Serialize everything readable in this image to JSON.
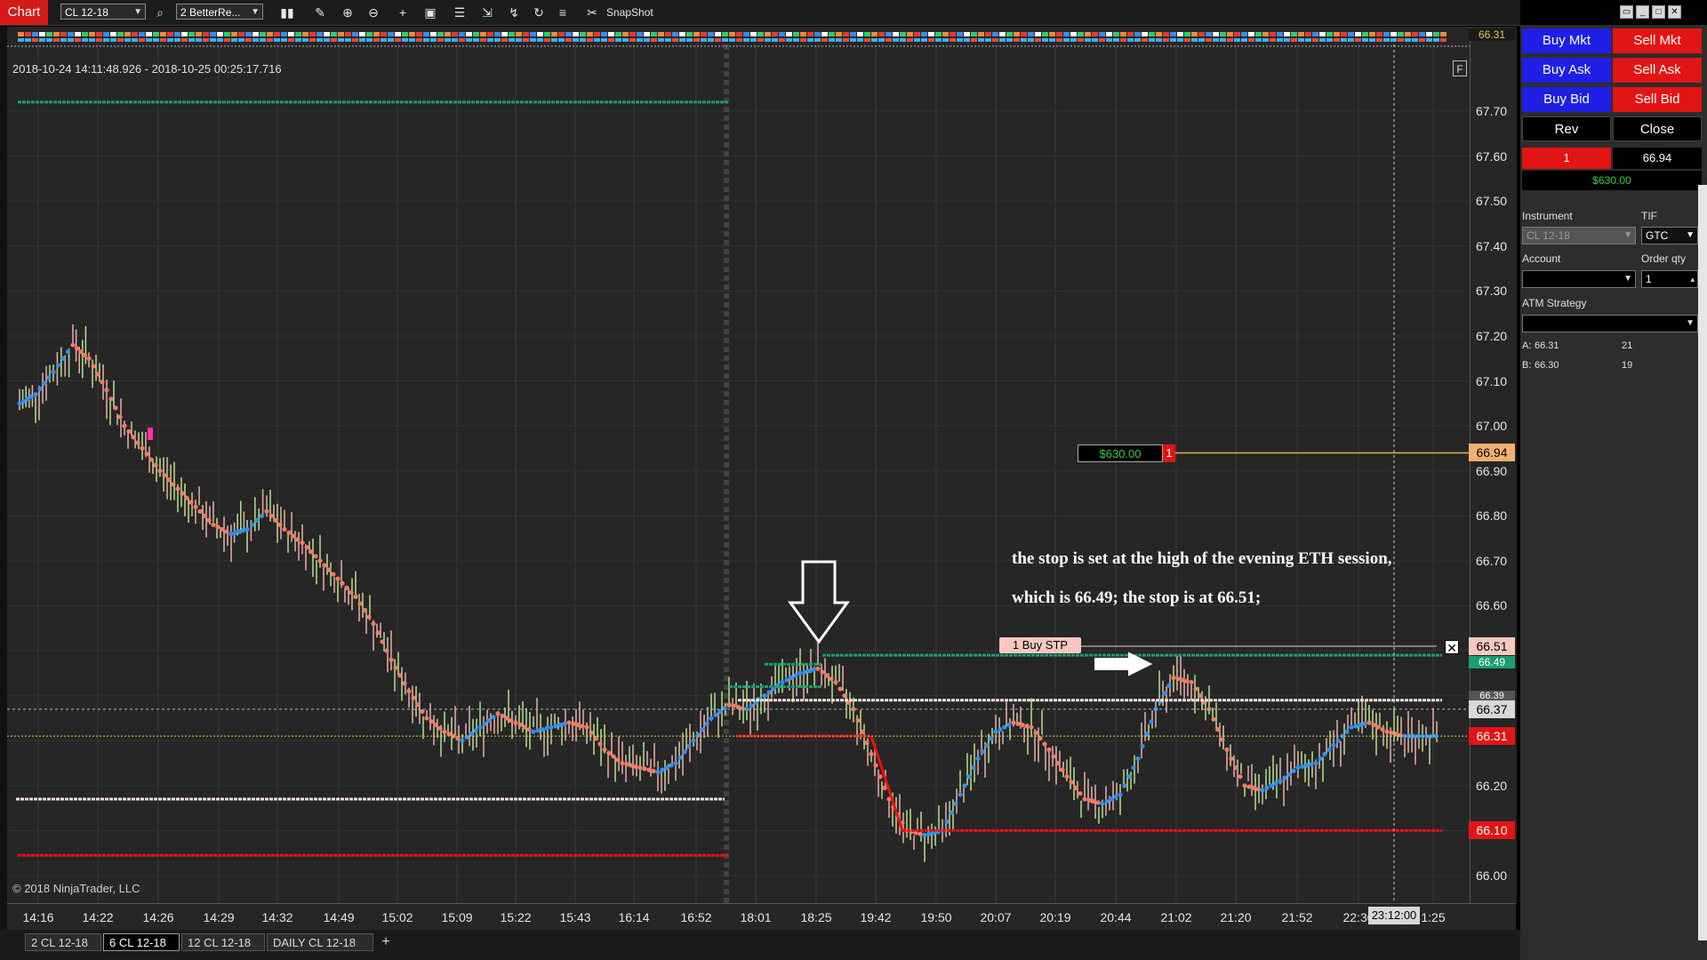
{
  "toolbar": {
    "tab_label": "Chart",
    "instrument": "CL 12-18",
    "indicator": "2 BetterRe...",
    "snapshot_label": "SnapShot"
  },
  "chart": {
    "range_text": "2018-10-24 14:11:48.926 - 2018-10-25 00:25:17.716",
    "copyright": "© 2018 NinjaTrader, LLC",
    "annotation_line1": "the stop is set at the high of the evening ETH session,",
    "annotation_line2": "which is 66.49; the stop is at 66.51;",
    "position_pnl": "$630.00",
    "position_qty": "1",
    "stop_order_label": "1  Buy STP",
    "f_button": "F",
    "price_ticks": [
      "67.70",
      "67.60",
      "67.50",
      "67.40",
      "67.30",
      "67.20",
      "67.10",
      "67.00",
      "66.90",
      "66.80",
      "66.70",
      "66.60",
      "66.50",
      "66.40",
      "66.30",
      "66.20",
      "66.10",
      "66.00"
    ],
    "time_ticks": [
      "14:16",
      "14:22",
      "14:26",
      "14:29",
      "14:32",
      "14:49",
      "15:02",
      "15:09",
      "15:22",
      "15:43",
      "16:14",
      "16:52",
      "18:01",
      "18:25",
      "19:42",
      "19:50",
      "20:07",
      "20:19",
      "20:44",
      "21:02",
      "21:20",
      "21:52",
      "22:30",
      "1:25"
    ],
    "crosshair_time": "23:12:00",
    "price_tags": {
      "top": "66.31",
      "entry": "66.94",
      "stop": "66.51",
      "eth_high": "66.49",
      "white_line": "66.39",
      "crosshair": "66.37",
      "last": "66.31",
      "low": "66.10"
    },
    "colors": {
      "uptrend": "#2f8ff0",
      "downtrend": "#f07b66",
      "bull_bar": "#b8e08a",
      "bear_bar": "#e8b0a8",
      "high_line": "#1a9e73",
      "low_line": "#f01010"
    }
  },
  "bottom_tabs": [
    {
      "label": "2  CL 12-18"
    },
    {
      "label": "6  CL 12-18"
    },
    {
      "label": "12  CL 12-18"
    },
    {
      "label": "DAILY  CL 12-18"
    },
    {
      "label": "+"
    }
  ],
  "order_panel": {
    "buy_mkt": "Buy Mkt",
    "sell_mkt": "Sell Mkt",
    "buy_ask": "Buy Ask",
    "sell_ask": "Sell Ask",
    "buy_bid": "Buy Bid",
    "sell_bid": "Sell Bid",
    "rev": "Rev",
    "close": "Close",
    "position_qty": "1",
    "avg_price": "66.94",
    "pnl": "$630.00",
    "instrument_label": "Instrument",
    "tif_label": "TIF",
    "instrument_value": "CL 12-18",
    "tif_value": "GTC",
    "account_label": "Account",
    "order_qty_label": "Order qty",
    "order_qty_value": "1",
    "atm_label": "ATM Strategy",
    "ask_label": "A:",
    "ask_price": "66.31",
    "ask_size": "21",
    "bid_label": "B:",
    "bid_price": "66.30",
    "bid_size": "19"
  }
}
